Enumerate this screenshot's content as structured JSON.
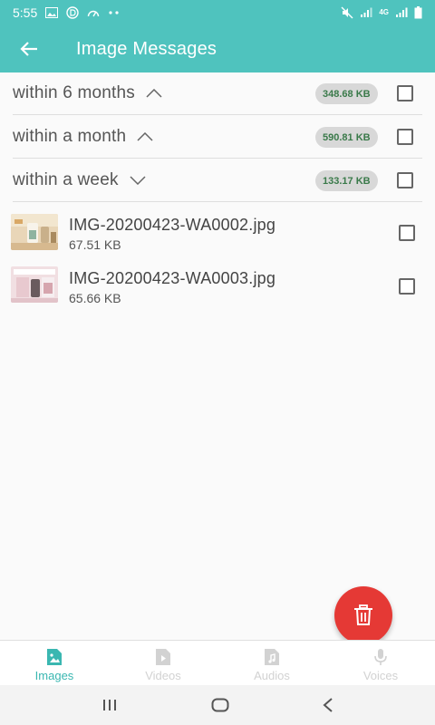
{
  "status_bar": {
    "time": "5:55",
    "network_label": "4G",
    "left_icons": [
      "image-icon",
      "circle-d-icon",
      "gauge-icon",
      "more-dots-icon"
    ],
    "right_icons": [
      "mute-icon",
      "signal-icon",
      "signal-icon",
      "battery-icon"
    ]
  },
  "app_bar": {
    "title": "Image Messages",
    "back_icon": "arrow-left-icon"
  },
  "groups": [
    {
      "label": "within 6 months",
      "size": "348.68 KB",
      "expanded": false,
      "chevron": "chevron-up-icon"
    },
    {
      "label": "within a month",
      "size": "590.81 KB",
      "expanded": false,
      "chevron": "chevron-up-icon"
    },
    {
      "label": "within a week",
      "size": "133.17 KB",
      "expanded": true,
      "chevron": "chevron-down-icon"
    }
  ],
  "files": [
    {
      "name": "IMG-20200423-WA0002.jpg",
      "size": "67.51 KB"
    },
    {
      "name": "IMG-20200423-WA0003.jpg",
      "size": "65.66 KB"
    }
  ],
  "fab": {
    "icon": "trash-icon"
  },
  "bottom_nav": [
    {
      "label": "Images",
      "icon": "image-file-icon",
      "active": true
    },
    {
      "label": "Videos",
      "icon": "video-file-icon",
      "active": false
    },
    {
      "label": "Audios",
      "icon": "audio-file-icon",
      "active": false
    },
    {
      "label": "Voices",
      "icon": "mic-icon",
      "active": false
    }
  ],
  "system_nav": [
    "recents-icon",
    "home-icon",
    "back-icon"
  ],
  "colors": {
    "primary": "#4fc3be",
    "accent_active": "#3ab7b1",
    "fab": "#e53935",
    "badge_bg": "#d8d8d8",
    "badge_text": "#3a7a4a"
  }
}
